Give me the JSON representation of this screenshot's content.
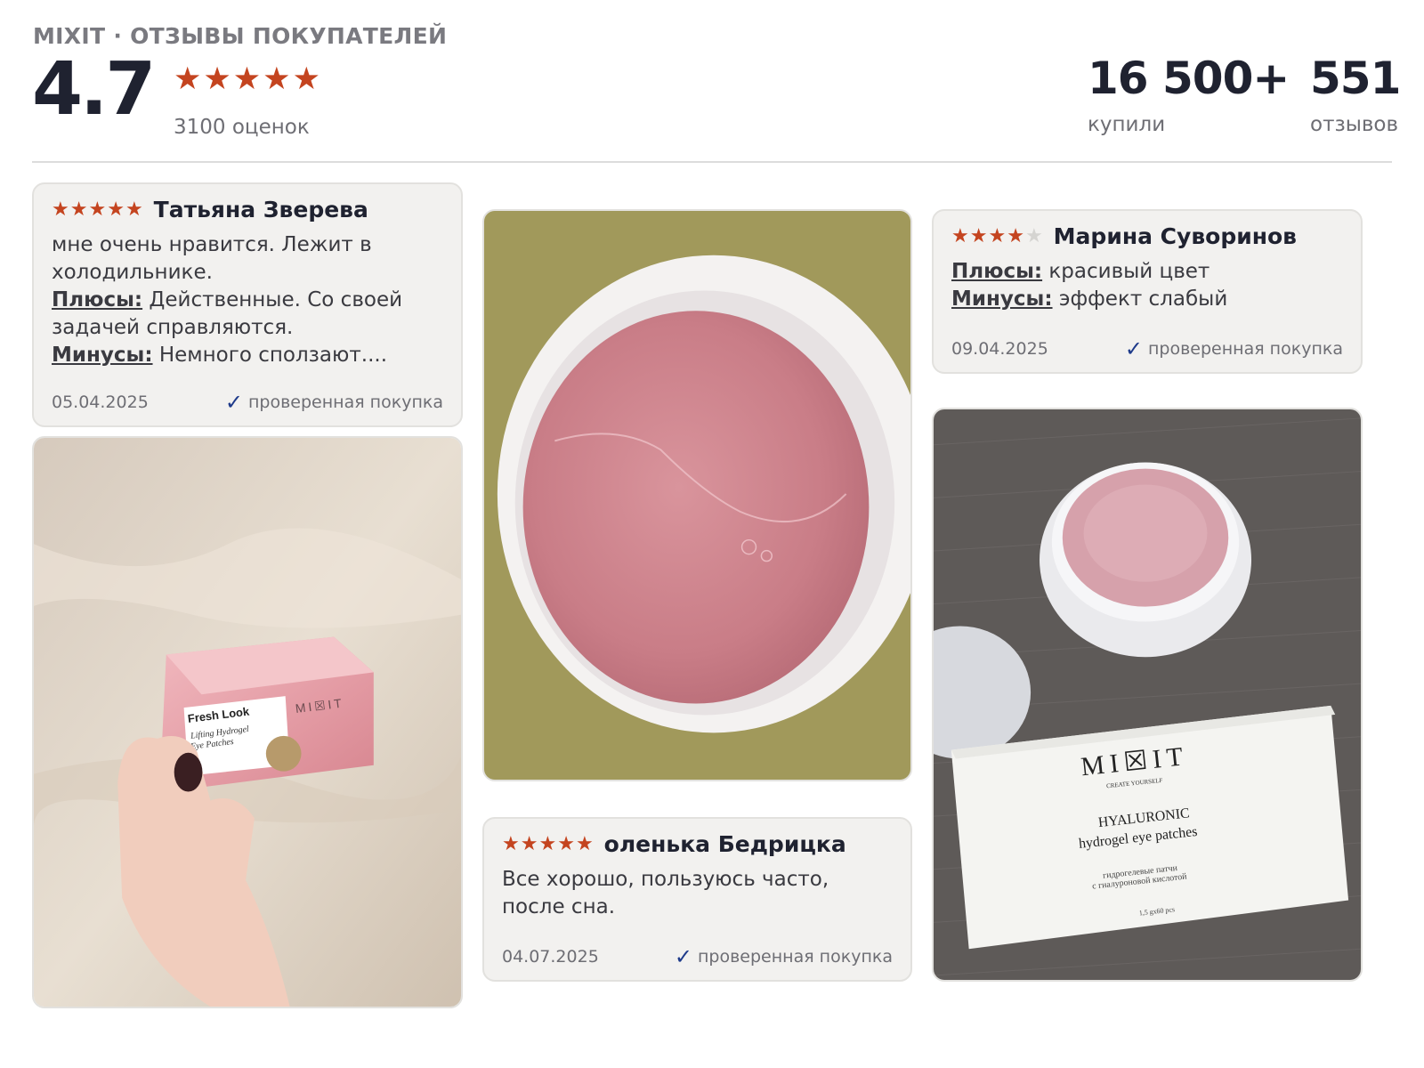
{
  "header": {
    "brand": "MIXIT · ОТЗЫВЫ ПОКУПАТЕЛЕЙ",
    "rating": "4.7",
    "stars": 5,
    "rating_count": "3100 оценок",
    "bought_value": "16 500+",
    "bought_label": "купили",
    "reviews_value": "551",
    "reviews_label": "отзывов"
  },
  "colors": {
    "star": "#c4441f",
    "star_off": "#d5d4d1",
    "check": "#1e3a8a",
    "card_bg": "#f2f1ef"
  },
  "icons": {
    "star": "star-icon",
    "verified": "checkmark-icon"
  },
  "reviews": [
    {
      "author": "Татьяна Зверева",
      "rating": 5,
      "text": "мне очень нравится. Лежит в холодильнике.",
      "plus_label": "Плюсы:",
      "plus": "Действенные. Со своей задачей справляются.",
      "minus_label": "Минусы:",
      "minus": "Немного сползают....",
      "date": "05.04.2025",
      "verified": "проверенная покупка"
    },
    {
      "author": "оленька Бедрицка",
      "rating": 5,
      "text": "Все хорошо, пользуюсь часто, после сна.",
      "date": "04.07.2025",
      "verified": "проверенная покупка"
    },
    {
      "author": "Марина Суворинов",
      "rating": 4,
      "plus_label": "Плюсы:",
      "plus": "красивый цвет",
      "minus_label": "Минусы:",
      "minus": "эффект слабый",
      "date": "09.04.2025",
      "verified": "проверенная покупка"
    }
  ],
  "photos": {
    "photo1": {
      "box_brand": "MI☒IT",
      "box_title": "Fresh Look",
      "box_subtitle_1": "Lifting Hydrogel",
      "box_subtitle_2": "Eye Patches"
    },
    "photo3": {
      "box_brand": "MI☒IT",
      "box_tagline": "CREATE YOURSELF",
      "box_title_1": "HYALURONIC",
      "box_title_2": "hydrogel eye patches",
      "box_ru_1": "гидрогелевые патчи",
      "box_ru_2": "с гиалуроновой кислотой",
      "box_qty": "1,5 gx60 pcs"
    }
  }
}
